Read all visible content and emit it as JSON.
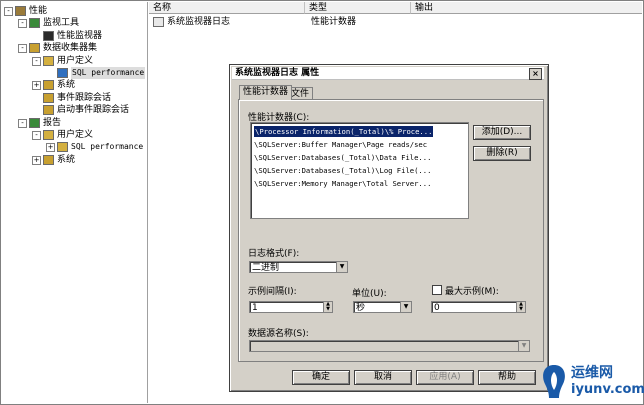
{
  "tree": {
    "items": [
      {
        "label": "性能",
        "expander": "-",
        "level": 0
      },
      {
        "label": "监视工具",
        "expander": "-",
        "level": 1
      },
      {
        "label": "性能监视器",
        "expander": "",
        "level": 2
      },
      {
        "label": "数据收集器集",
        "expander": "-",
        "level": 1
      },
      {
        "label": "用户定义",
        "expander": "-",
        "level": 2
      },
      {
        "label": "SQL performance",
        "expander": "",
        "level": 3
      },
      {
        "label": "系统",
        "expander": "+",
        "level": 2
      },
      {
        "label": "事件跟踪会话",
        "expander": "",
        "level": 2
      },
      {
        "label": "启动事件跟踪会话",
        "expander": "",
        "level": 2
      },
      {
        "label": "报告",
        "expander": "-",
        "level": 1
      },
      {
        "label": "用户定义",
        "expander": "-",
        "level": 2
      },
      {
        "label": "SQL performance",
        "expander": "+",
        "level": 3
      },
      {
        "label": "系统",
        "expander": "+",
        "level": 2
      }
    ]
  },
  "list": {
    "columns": [
      "名称",
      "类型",
      "输出"
    ],
    "rows": [
      {
        "name": "系统监视器日志",
        "type": "性能计数器",
        "output": ""
      }
    ]
  },
  "dialog": {
    "title": "系统监视器日志 属性",
    "close_glyph": "×",
    "tabs": [
      "性能计数器",
      "文件"
    ],
    "counters_label": "性能计数器(C):",
    "counters": [
      "\\Processor Information(_Total)\\% Proce...",
      "\\SQLServer:Buffer Manager\\Page reads/sec",
      "\\SQLServer:Databases(_Total)\\Data File...",
      "\\SQLServer:Databases(_Total)\\Log File(...",
      "\\SQLServer:Memory Manager\\Total Server..."
    ],
    "add_button": "添加(D)...",
    "remove_button": "删除(R)",
    "log_format_label": "日志格式(F):",
    "log_format_value": "二进制",
    "interval_label": "示例间隔(I):",
    "interval_value": "1",
    "units_label": "单位(U):",
    "units_value": "秒",
    "max_samples_label": "最大示例(M):",
    "max_samples_value": "0",
    "dsn_label": "数据源名称(S):",
    "dsn_value": "",
    "ok_button": "确定",
    "cancel_button": "取消",
    "apply_button": "应用(A)",
    "help_button": "帮助"
  },
  "watermark": {
    "line1": "运维网",
    "line2": "iyunv.com"
  },
  "colors": {
    "selection": "#0a246a",
    "dialog_bg": "#d4d0c8",
    "watermark_blue": "#1a5aa8"
  }
}
